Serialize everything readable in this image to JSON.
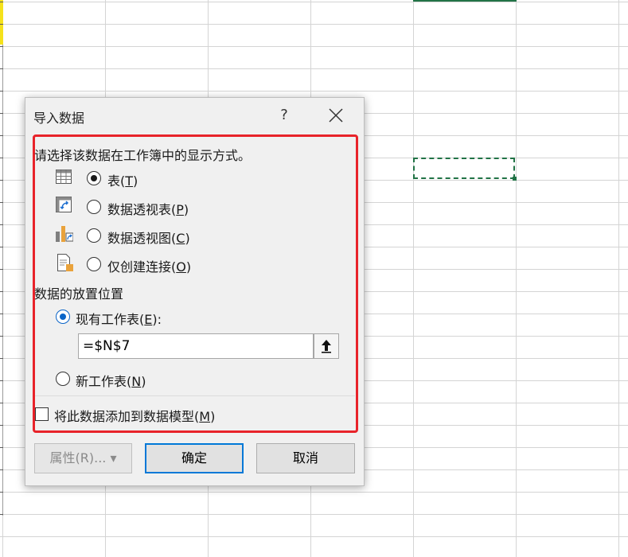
{
  "dialog": {
    "title": "导入数据",
    "help": "?",
    "section1": {
      "heading": "请选择该数据在工作簿中的显示方式。",
      "options": [
        {
          "label": "表",
          "key": "(T)",
          "key_u": "T",
          "icon": "table-icon",
          "checked": true
        },
        {
          "label": "数据透视表",
          "key": "(P)",
          "key_u": "P",
          "icon": "pivot-table-icon",
          "checked": false
        },
        {
          "label": "数据透视图",
          "key": "(C)",
          "key_u": "C",
          "icon": "pivot-chart-icon",
          "checked": false
        },
        {
          "label": "仅创建连接",
          "key": "(O)",
          "key_u": "O",
          "icon": "connection-only-icon",
          "checked": false
        }
      ]
    },
    "section2": {
      "heading": "数据的放置位置",
      "existing": {
        "label": "现有工作表",
        "key": "E",
        "suffix": "):"
      },
      "reference_value": "=$N$7",
      "new_sheet": {
        "label": "新工作表",
        "key": "N"
      }
    },
    "data_model": {
      "label": "将此数据添加到数据模型",
      "key": "M"
    },
    "buttons": {
      "properties": "属性(R)...",
      "properties_arrow": "▾",
      "ok": "确定",
      "cancel": "取消"
    }
  },
  "colors": {
    "highlight": "#e8232a",
    "accent": "#0078d7",
    "sheet_green": "#217346"
  }
}
